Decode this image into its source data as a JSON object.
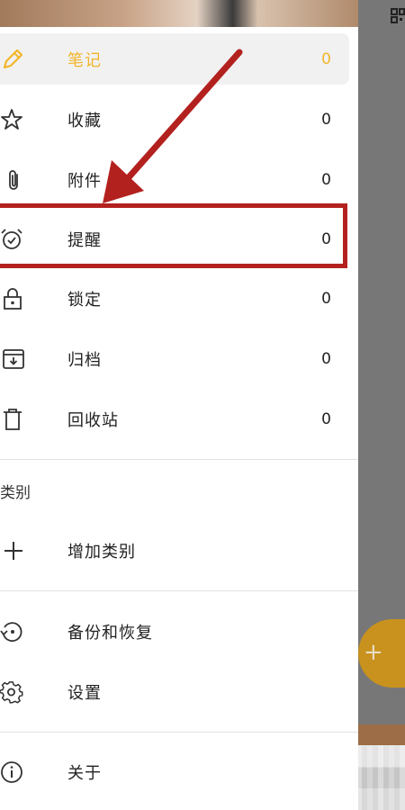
{
  "drawer": {
    "items": [
      {
        "label": "笔记",
        "count": "0",
        "icon": "pencil-icon",
        "selected": true
      },
      {
        "label": "收藏",
        "count": "0",
        "icon": "star-icon"
      },
      {
        "label": "附件",
        "count": "0",
        "icon": "paperclip-icon"
      },
      {
        "label": "提醒",
        "count": "0",
        "icon": "alarm-clock-icon"
      },
      {
        "label": "锁定",
        "count": "0",
        "icon": "lock-icon"
      },
      {
        "label": "归档",
        "count": "0",
        "icon": "archive-icon"
      },
      {
        "label": "回收站",
        "count": "0",
        "icon": "trash-icon"
      }
    ],
    "category_section": {
      "title": "类别",
      "add_label": "增加类别"
    },
    "footer_items": [
      {
        "label": "备份和恢复",
        "icon": "backup-restore-icon"
      },
      {
        "label": "设置",
        "icon": "gear-icon"
      },
      {
        "label": "关于",
        "icon": "info-icon"
      }
    ]
  },
  "colors": {
    "accent": "#f2b52a",
    "annotation": "#b3211f",
    "fab": "#c9921e"
  },
  "background": {
    "fab_label": "+"
  }
}
